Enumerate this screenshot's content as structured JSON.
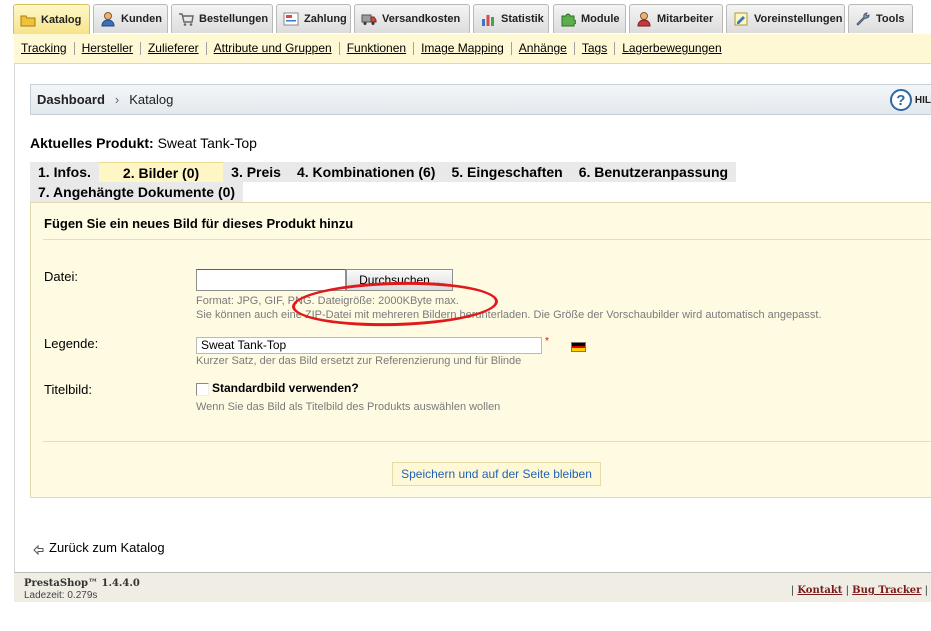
{
  "top_tabs": [
    {
      "label": "Katalog",
      "icon": "folder-icon",
      "active": true
    },
    {
      "label": "Kunden",
      "icon": "user-icon",
      "active": false
    },
    {
      "label": "Bestellungen",
      "icon": "cart-icon",
      "active": false
    },
    {
      "label": "Zahlung",
      "icon": "payment-icon",
      "active": false
    },
    {
      "label": "Versandkosten",
      "icon": "truck-icon",
      "active": false
    },
    {
      "label": "Statistik",
      "icon": "chart-icon",
      "active": false
    },
    {
      "label": "Module",
      "icon": "puzzle-icon",
      "active": false
    },
    {
      "label": "Mitarbeiter",
      "icon": "employee-icon",
      "active": false
    },
    {
      "label": "Voreinstellungen",
      "icon": "preferences-icon",
      "active": false
    },
    {
      "label": "Tools",
      "icon": "wrench-icon",
      "active": false
    }
  ],
  "sub_menu": [
    "Tracking",
    "Hersteller",
    "Zulieferer",
    "Attribute und Gruppen",
    "Funktionen",
    "Image Mapping",
    "Anhänge",
    "Tags",
    "Lagerbewegungen"
  ],
  "breadcrumb": {
    "home": "Dashboard",
    "separator": "›",
    "current": "Katalog"
  },
  "help": {
    "icon": "?",
    "label": "HIL"
  },
  "product": {
    "label": "Aktuelles Produkt:",
    "name": "Sweat Tank-Top"
  },
  "product_tabs": {
    "row1": [
      "1. Infos.",
      "2. Bilder (0)",
      "3. Preis",
      "4. Kombinationen (6)",
      "5. Eingeschaften",
      "6. Benutzeranpassung"
    ],
    "row2": [
      "7. Angehängte Dokumente (0)"
    ],
    "active": "2. Bilder (0)"
  },
  "form": {
    "heading": "Fügen Sie ein neues Bild für dieses Produkt hinzu",
    "file": {
      "label": "Datei:",
      "value": "",
      "button": "Durchsuchen...",
      "hint1": "Format: JPG, GIF, PNG. Dateigröße: 2000KByte max.",
      "hint2": "Sie können auch eine ZIP-Datei mit mehreren Bildern herunterladen. Die Größe der Vorschaubilder wird automatisch angepasst."
    },
    "legend": {
      "label": "Legende:",
      "value": "Sweat Tank-Top",
      "required": "*",
      "hint": "Kurzer Satz, der das Bild ersetzt zur Referenzierung und für Blinde",
      "flag": "german-flag-icon"
    },
    "cover": {
      "label": "Titelbild:",
      "checkbox_label": "Standardbild verwenden?",
      "checked": false,
      "hint": "Wenn Sie das Bild als Titelbild des Produkts auswählen wollen"
    },
    "save_button": "Speichern und auf der Seite bleiben"
  },
  "back_link": "Zurück zum Katalog",
  "footer": {
    "brand": "PrestaShop™ 1.4.4.0",
    "load_time": "Ladezeit: 0.279s",
    "sep": "|",
    "links": [
      "Kontakt",
      "Bug Tracker"
    ]
  },
  "colors": {
    "active_tab": "#f6e38a",
    "submenu_bg": "#fff8d4",
    "panel_bg": "#fffbe3",
    "link_blue": "#1e63b8",
    "annotation_red": "#e0191c"
  }
}
